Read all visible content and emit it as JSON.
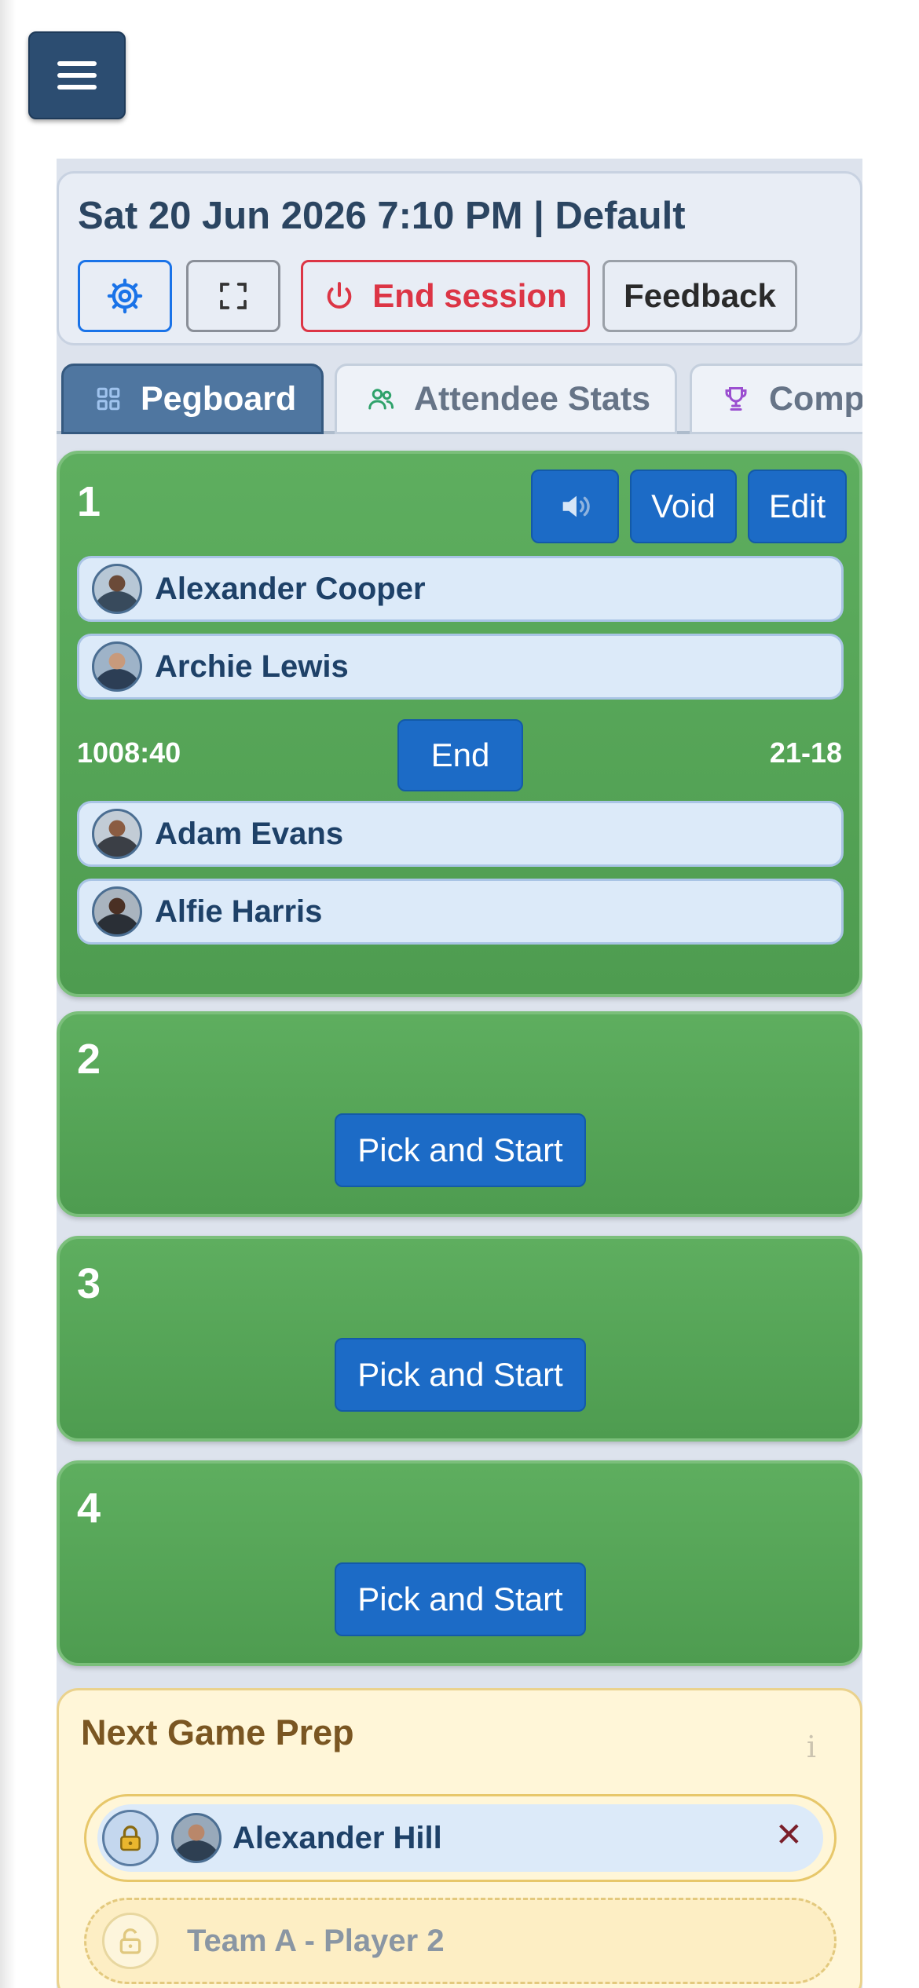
{
  "header": {
    "title": "Sat 20 Jun 2026 7:10 PM | Default",
    "end_session_label": "End session",
    "feedback_label": "Feedback"
  },
  "tabs": [
    {
      "label": "Pegboard",
      "icon": "grid-icon",
      "active": true
    },
    {
      "label": "Attendee Stats",
      "icon": "users-icon",
      "active": false
    },
    {
      "label": "Comp",
      "icon": "trophy-icon",
      "active": false
    }
  ],
  "courts": [
    {
      "number": "1",
      "buttons": {
        "void_label": "Void",
        "edit_label": "Edit",
        "end_label": "End"
      },
      "team_a": [
        "Alexander Cooper",
        "Archie Lewis"
      ],
      "team_b": [
        "Adam Evans",
        "Alfie Harris"
      ],
      "timer": "1008:40",
      "score": "21-18"
    },
    {
      "number": "2",
      "action_label": "Pick and Start"
    },
    {
      "number": "3",
      "action_label": "Pick and Start"
    },
    {
      "number": "4",
      "action_label": "Pick and Start"
    }
  ],
  "next_game_prep": {
    "title": "Next Game Prep",
    "info_glyph": "i",
    "slots": [
      {
        "name": "Alexander Hill",
        "locked": true,
        "remove_glyph": "✕"
      },
      {
        "placeholder": "Team A - Player 2",
        "locked": false
      }
    ]
  },
  "colors": {
    "accent_blue": "#1c6bc6",
    "court_green": "#58a85a",
    "danger_red": "#dc3545",
    "prep_bg": "#fff6d8"
  }
}
